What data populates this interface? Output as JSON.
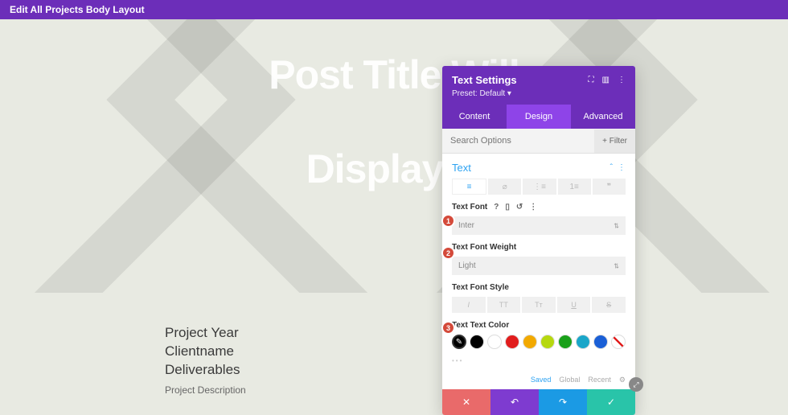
{
  "topBar": {
    "title": "Edit All Projects Body Layout"
  },
  "hero": {
    "line1": "Post Title Will",
    "line2": "Display H"
  },
  "project": {
    "year": "Project Year",
    "client": "Clientname",
    "deliverables": "Deliverables",
    "description": "Project Description"
  },
  "panel": {
    "title": "Text Settings",
    "preset": "Preset: Default ▾",
    "tabs": {
      "content": "Content",
      "design": "Design",
      "advanced": "Advanced"
    },
    "searchPlaceholder": "Search Options",
    "filter": "+  Filter",
    "sectionTitle": "Text",
    "font": {
      "label": "Text Font",
      "value": "Inter"
    },
    "weight": {
      "label": "Text Font Weight",
      "value": "Light"
    },
    "style": {
      "label": "Text Font Style"
    },
    "color": {
      "label": "Text Text Color",
      "swatches": [
        "#000000",
        "#000000",
        "#ffffff",
        "#e11d1d",
        "#f2a900",
        "#b6d80f",
        "#1aa01a",
        "#1aa6c9",
        "#1a5fd6"
      ],
      "tabs": {
        "saved": "Saved",
        "global": "Global",
        "recent": "Recent"
      }
    }
  },
  "badges": {
    "b1": "1",
    "b2": "2",
    "b3": "3"
  }
}
